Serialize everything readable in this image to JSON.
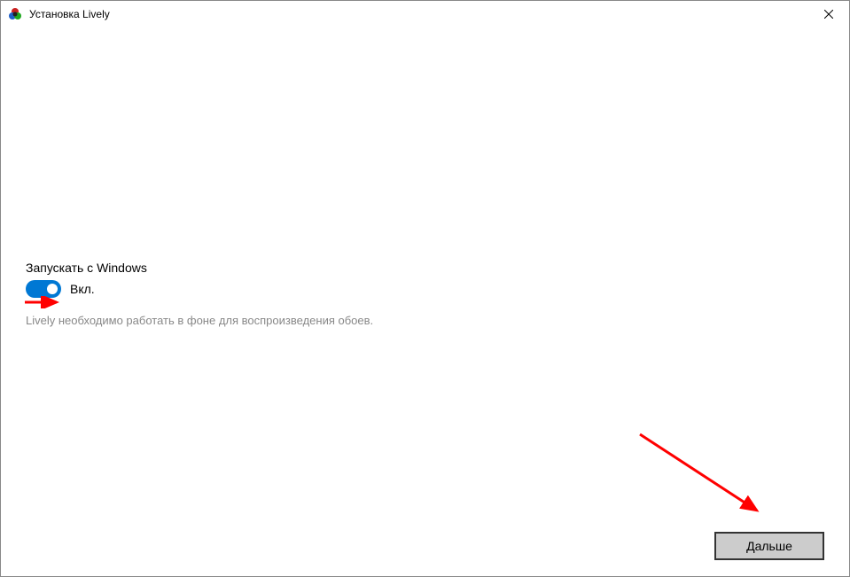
{
  "window": {
    "title": "Установка Lively"
  },
  "setting": {
    "title": "Запускать с Windows",
    "toggle_state": "Вкл.",
    "description": "Lively необходимо работать в фоне для воспроизведения обоев."
  },
  "buttons": {
    "next": "Дальше"
  }
}
